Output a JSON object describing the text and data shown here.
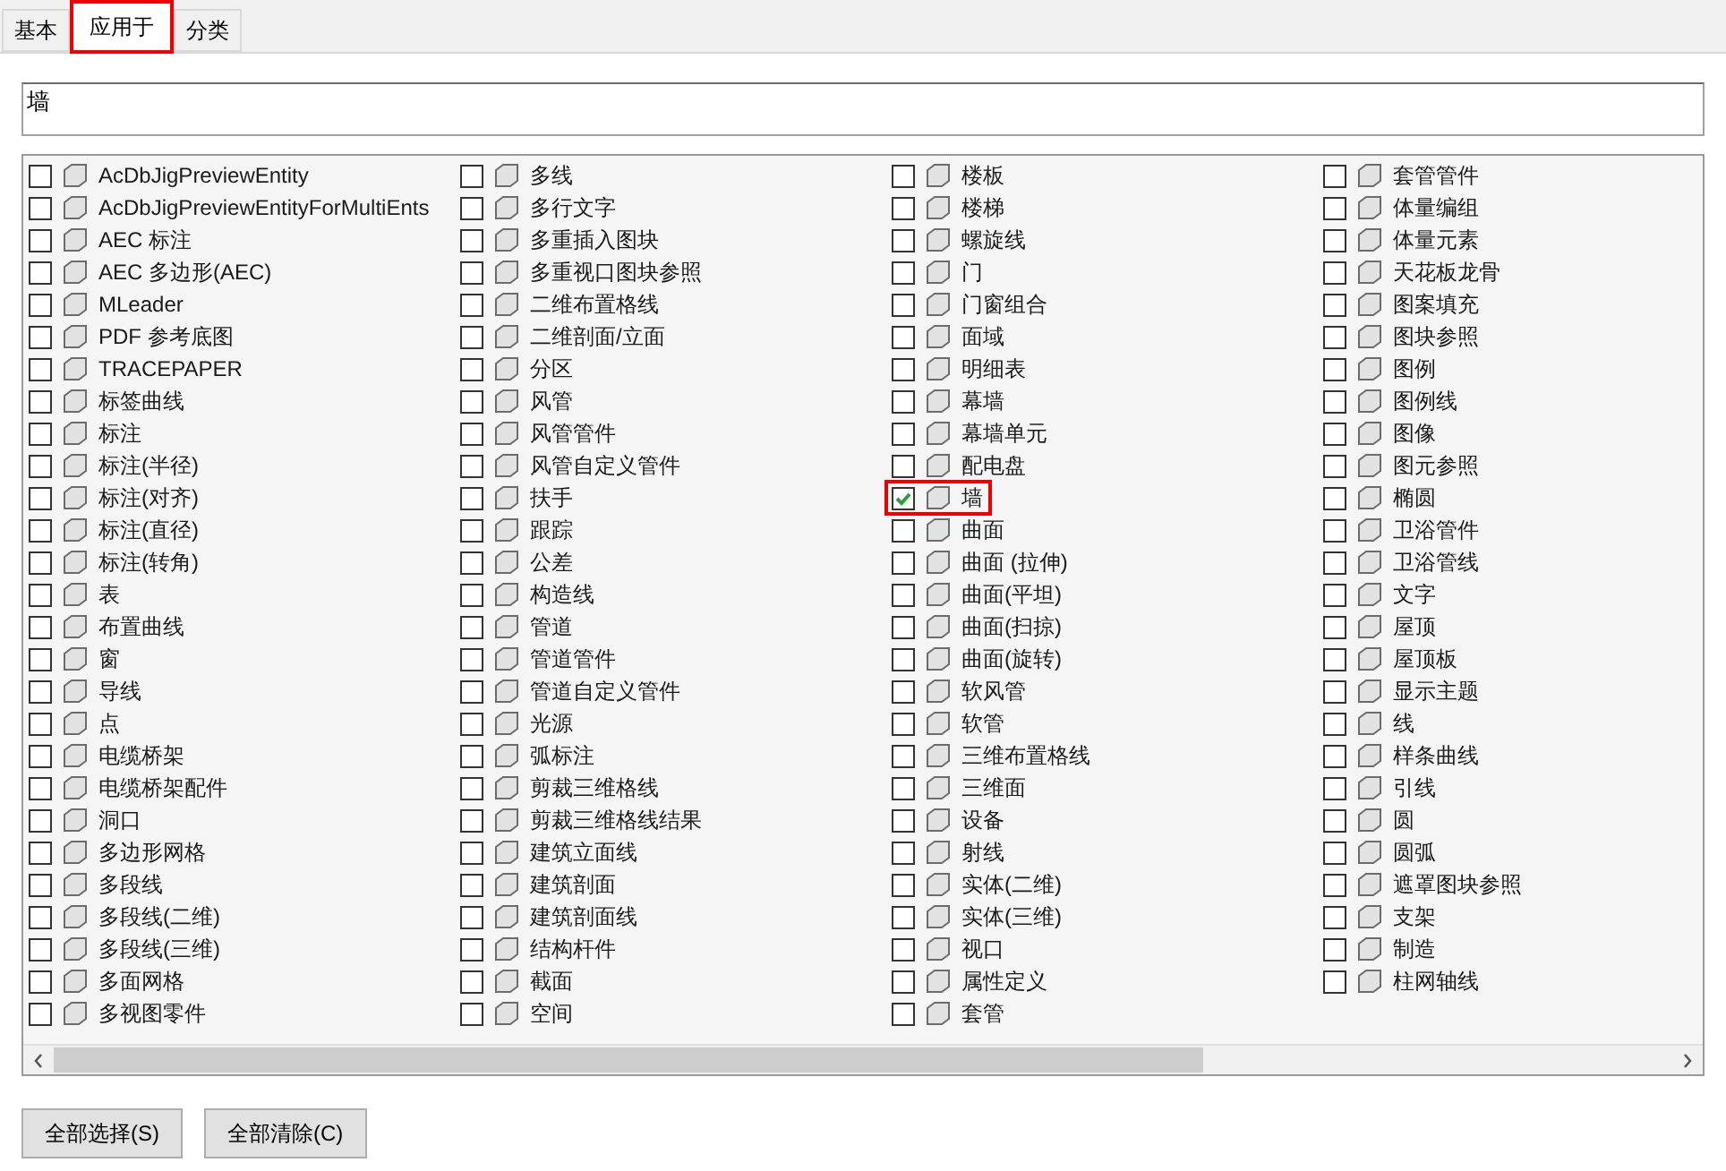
{
  "tabs": [
    {
      "label": "基本",
      "selected": false,
      "highlighted": false
    },
    {
      "label": "应用于",
      "selected": true,
      "highlighted": true
    },
    {
      "label": "分类",
      "selected": false,
      "highlighted": false
    }
  ],
  "filter_field": {
    "value": "墙"
  },
  "items": [
    {
      "label": "AcDbJigPreviewEntity",
      "checked": false,
      "highlighted": false
    },
    {
      "label": "AcDbJigPreviewEntityForMultiEnts",
      "checked": false,
      "highlighted": false
    },
    {
      "label": "AEC 标注",
      "checked": false,
      "highlighted": false
    },
    {
      "label": "AEC 多边形(AEC)",
      "checked": false,
      "highlighted": false
    },
    {
      "label": "MLeader",
      "checked": false,
      "highlighted": false
    },
    {
      "label": "PDF 参考底图",
      "checked": false,
      "highlighted": false
    },
    {
      "label": "TRACEPAPER",
      "checked": false,
      "highlighted": false
    },
    {
      "label": "标签曲线",
      "checked": false,
      "highlighted": false
    },
    {
      "label": "标注",
      "checked": false,
      "highlighted": false
    },
    {
      "label": "标注(半径)",
      "checked": false,
      "highlighted": false
    },
    {
      "label": "标注(对齐)",
      "checked": false,
      "highlighted": false
    },
    {
      "label": "标注(直径)",
      "checked": false,
      "highlighted": false
    },
    {
      "label": "标注(转角)",
      "checked": false,
      "highlighted": false
    },
    {
      "label": "表",
      "checked": false,
      "highlighted": false
    },
    {
      "label": "布置曲线",
      "checked": false,
      "highlighted": false
    },
    {
      "label": "窗",
      "checked": false,
      "highlighted": false
    },
    {
      "label": "导线",
      "checked": false,
      "highlighted": false
    },
    {
      "label": "点",
      "checked": false,
      "highlighted": false
    },
    {
      "label": "电缆桥架",
      "checked": false,
      "highlighted": false
    },
    {
      "label": "电缆桥架配件",
      "checked": false,
      "highlighted": false
    },
    {
      "label": "洞口",
      "checked": false,
      "highlighted": false
    },
    {
      "label": "多边形网格",
      "checked": false,
      "highlighted": false
    },
    {
      "label": "多段线",
      "checked": false,
      "highlighted": false
    },
    {
      "label": "多段线(二维)",
      "checked": false,
      "highlighted": false
    },
    {
      "label": "多段线(三维)",
      "checked": false,
      "highlighted": false
    },
    {
      "label": "多面网格",
      "checked": false,
      "highlighted": false
    },
    {
      "label": "多视图零件",
      "checked": false,
      "highlighted": false
    },
    {
      "label": "多线",
      "checked": false,
      "highlighted": false
    },
    {
      "label": "多行文字",
      "checked": false,
      "highlighted": false
    },
    {
      "label": "多重插入图块",
      "checked": false,
      "highlighted": false
    },
    {
      "label": "多重视口图块参照",
      "checked": false,
      "highlighted": false
    },
    {
      "label": "二维布置格线",
      "checked": false,
      "highlighted": false
    },
    {
      "label": "二维剖面/立面",
      "checked": false,
      "highlighted": false
    },
    {
      "label": "分区",
      "checked": false,
      "highlighted": false
    },
    {
      "label": "风管",
      "checked": false,
      "highlighted": false
    },
    {
      "label": "风管管件",
      "checked": false,
      "highlighted": false
    },
    {
      "label": "风管自定义管件",
      "checked": false,
      "highlighted": false
    },
    {
      "label": "扶手",
      "checked": false,
      "highlighted": false
    },
    {
      "label": "跟踪",
      "checked": false,
      "highlighted": false
    },
    {
      "label": "公差",
      "checked": false,
      "highlighted": false
    },
    {
      "label": "构造线",
      "checked": false,
      "highlighted": false
    },
    {
      "label": "管道",
      "checked": false,
      "highlighted": false
    },
    {
      "label": "管道管件",
      "checked": false,
      "highlighted": false
    },
    {
      "label": "管道自定义管件",
      "checked": false,
      "highlighted": false
    },
    {
      "label": "光源",
      "checked": false,
      "highlighted": false
    },
    {
      "label": "弧标注",
      "checked": false,
      "highlighted": false
    },
    {
      "label": "剪裁三维格线",
      "checked": false,
      "highlighted": false
    },
    {
      "label": "剪裁三维格线结果",
      "checked": false,
      "highlighted": false
    },
    {
      "label": "建筑立面线",
      "checked": false,
      "highlighted": false
    },
    {
      "label": "建筑剖面",
      "checked": false,
      "highlighted": false
    },
    {
      "label": "建筑剖面线",
      "checked": false,
      "highlighted": false
    },
    {
      "label": "结构杆件",
      "checked": false,
      "highlighted": false
    },
    {
      "label": "截面",
      "checked": false,
      "highlighted": false
    },
    {
      "label": "空间",
      "checked": false,
      "highlighted": false
    },
    {
      "label": "楼板",
      "checked": false,
      "highlighted": false
    },
    {
      "label": "楼梯",
      "checked": false,
      "highlighted": false
    },
    {
      "label": "螺旋线",
      "checked": false,
      "highlighted": false
    },
    {
      "label": "门",
      "checked": false,
      "highlighted": false
    },
    {
      "label": "门窗组合",
      "checked": false,
      "highlighted": false
    },
    {
      "label": "面域",
      "checked": false,
      "highlighted": false
    },
    {
      "label": "明细表",
      "checked": false,
      "highlighted": false
    },
    {
      "label": "幕墙",
      "checked": false,
      "highlighted": false
    },
    {
      "label": "幕墙单元",
      "checked": false,
      "highlighted": false
    },
    {
      "label": "配电盘",
      "checked": false,
      "highlighted": false
    },
    {
      "label": "墙",
      "checked": true,
      "highlighted": true
    },
    {
      "label": "曲面",
      "checked": false,
      "highlighted": false
    },
    {
      "label": "曲面 (拉伸)",
      "checked": false,
      "highlighted": false
    },
    {
      "label": "曲面(平坦)",
      "checked": false,
      "highlighted": false
    },
    {
      "label": "曲面(扫掠)",
      "checked": false,
      "highlighted": false
    },
    {
      "label": "曲面(旋转)",
      "checked": false,
      "highlighted": false
    },
    {
      "label": "软风管",
      "checked": false,
      "highlighted": false
    },
    {
      "label": "软管",
      "checked": false,
      "highlighted": false
    },
    {
      "label": "三维布置格线",
      "checked": false,
      "highlighted": false
    },
    {
      "label": "三维面",
      "checked": false,
      "highlighted": false
    },
    {
      "label": "设备",
      "checked": false,
      "highlighted": false
    },
    {
      "label": "射线",
      "checked": false,
      "highlighted": false
    },
    {
      "label": "实体(二维)",
      "checked": false,
      "highlighted": false
    },
    {
      "label": "实体(三维)",
      "checked": false,
      "highlighted": false
    },
    {
      "label": "视口",
      "checked": false,
      "highlighted": false
    },
    {
      "label": "属性定义",
      "checked": false,
      "highlighted": false
    },
    {
      "label": "套管",
      "checked": false,
      "highlighted": false
    },
    {
      "label": "套管管件",
      "checked": false,
      "highlighted": false
    },
    {
      "label": "体量编组",
      "checked": false,
      "highlighted": false
    },
    {
      "label": "体量元素",
      "checked": false,
      "highlighted": false
    },
    {
      "label": "天花板龙骨",
      "checked": false,
      "highlighted": false
    },
    {
      "label": "图案填充",
      "checked": false,
      "highlighted": false
    },
    {
      "label": "图块参照",
      "checked": false,
      "highlighted": false
    },
    {
      "label": "图例",
      "checked": false,
      "highlighted": false
    },
    {
      "label": "图例线",
      "checked": false,
      "highlighted": false
    },
    {
      "label": "图像",
      "checked": false,
      "highlighted": false
    },
    {
      "label": "图元参照",
      "checked": false,
      "highlighted": false
    },
    {
      "label": "椭圆",
      "checked": false,
      "highlighted": false
    },
    {
      "label": "卫浴管件",
      "checked": false,
      "highlighted": false
    },
    {
      "label": "卫浴管线",
      "checked": false,
      "highlighted": false
    },
    {
      "label": "文字",
      "checked": false,
      "highlighted": false
    },
    {
      "label": "屋顶",
      "checked": false,
      "highlighted": false
    },
    {
      "label": "屋顶板",
      "checked": false,
      "highlighted": false
    },
    {
      "label": "显示主题",
      "checked": false,
      "highlighted": false
    },
    {
      "label": "线",
      "checked": false,
      "highlighted": false
    },
    {
      "label": "样条曲线",
      "checked": false,
      "highlighted": false
    },
    {
      "label": "引线",
      "checked": false,
      "highlighted": false
    },
    {
      "label": "圆",
      "checked": false,
      "highlighted": false
    },
    {
      "label": "圆弧",
      "checked": false,
      "highlighted": false
    },
    {
      "label": "遮罩图块参照",
      "checked": false,
      "highlighted": false
    },
    {
      "label": "支架",
      "checked": false,
      "highlighted": false
    },
    {
      "label": "制造",
      "checked": false,
      "highlighted": false
    },
    {
      "label": "柱网轴线",
      "checked": false,
      "highlighted": false
    }
  ],
  "buttons": [
    "全部选择(S)",
    "全部清除(C)"
  ]
}
